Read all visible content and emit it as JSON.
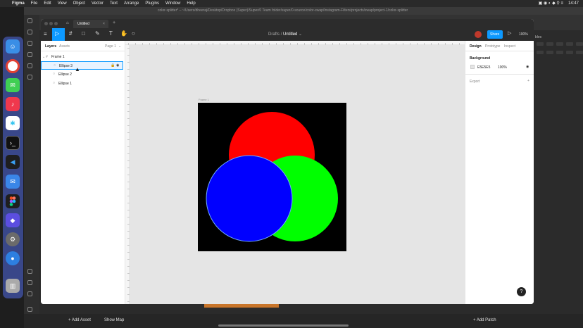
{
  "menubar": {
    "app": "Figma",
    "items": [
      "File",
      "Edit",
      "View",
      "Object",
      "Vector",
      "Text",
      "Arrange",
      "Plugins",
      "Window",
      "Help"
    ],
    "time": "14:47"
  },
  "bg_app": {
    "title": "color-splitter* – ~/Users/dheeraj/Desktop/Dropbox (Super)/Super/0 Team folder/super/0-source/color-swap/Instagram-Filters/projects/swap/project-1/color-splitter",
    "add_asset": "+ Add Asset",
    "show_map": "Show Map",
    "add_patch": "+ Add Patch"
  },
  "figma": {
    "tab_title": "Untitled",
    "breadcrumb_drafts": "Drafts",
    "breadcrumb_sep": "/",
    "file_name": "Untitled",
    "share_label": "Share",
    "zoom_label": "100%",
    "left_tabs": [
      "Layers",
      "Assets"
    ],
    "page_label": "Page 1",
    "layers": [
      {
        "name": "Frame 1",
        "type": "frame"
      },
      {
        "name": "Ellipse 3",
        "type": "ellipse"
      },
      {
        "name": "Ellipse 2",
        "type": "ellipse"
      },
      {
        "name": "Ellipse 1",
        "type": "ellipse"
      }
    ],
    "right_tabs": [
      "Design",
      "Prototype",
      "Inspect"
    ],
    "background_label": "Background",
    "background_hex": "E5E5E5",
    "background_opacity": "100%",
    "export_label": "Export",
    "frame_label": "Frame 1",
    "help_label": "?"
  },
  "colors": {
    "frame_bg": "#000000",
    "red": "#ff0000",
    "green": "#00ff00",
    "blue": "#0000ff",
    "accent": "#0d99ff"
  }
}
